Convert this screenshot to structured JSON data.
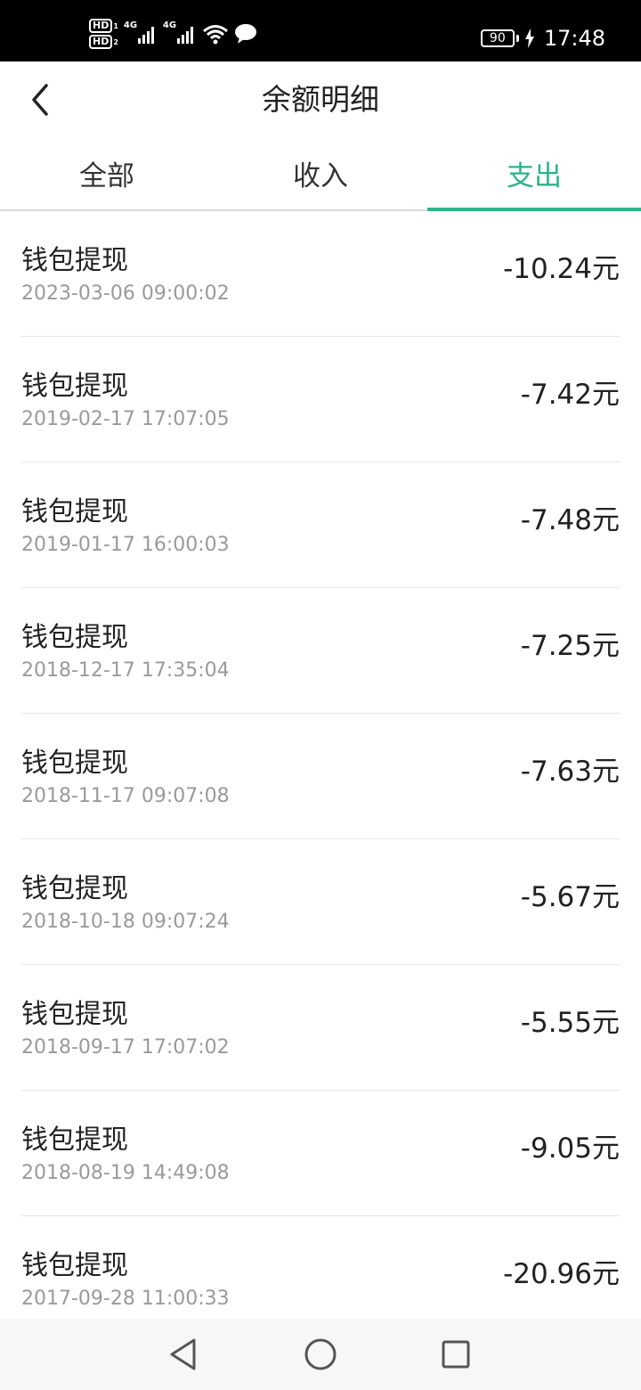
{
  "status_bar": {
    "hd1": "HD",
    "hd1_num": "1",
    "hd2": "HD",
    "hd2_num": "2",
    "sig1_label": "4G",
    "sig2_label": "4G",
    "battery": "90",
    "time": "17:48"
  },
  "header": {
    "title": "余额明细"
  },
  "tabs": [
    {
      "label": "全部",
      "active": false
    },
    {
      "label": "收入",
      "active": false
    },
    {
      "label": "支出",
      "active": true
    }
  ],
  "accent_color": "#2bb38a",
  "records": [
    {
      "title": "钱包提现",
      "time": "2023-03-06 09:00:02",
      "amount": "-10.24元"
    },
    {
      "title": "钱包提现",
      "time": "2019-02-17 17:07:05",
      "amount": "-7.42元"
    },
    {
      "title": "钱包提现",
      "time": "2019-01-17 16:00:03",
      "amount": "-7.48元"
    },
    {
      "title": "钱包提现",
      "time": "2018-12-17 17:35:04",
      "amount": "-7.25元"
    },
    {
      "title": "钱包提现",
      "time": "2018-11-17 09:07:08",
      "amount": "-7.63元"
    },
    {
      "title": "钱包提现",
      "time": "2018-10-18 09:07:24",
      "amount": "-5.67元"
    },
    {
      "title": "钱包提现",
      "time": "2018-09-17 17:07:02",
      "amount": "-5.55元"
    },
    {
      "title": "钱包提现",
      "time": "2018-08-19 14:49:08",
      "amount": "-9.05元"
    },
    {
      "title": "钱包提现",
      "time": "2017-09-28 11:00:33",
      "amount": "-20.96元"
    }
  ],
  "icons": {
    "back": "chevron-left-icon",
    "nav_back": "triangle-back-icon",
    "nav_home": "circle-home-icon",
    "nav_recents": "square-recents-icon"
  }
}
